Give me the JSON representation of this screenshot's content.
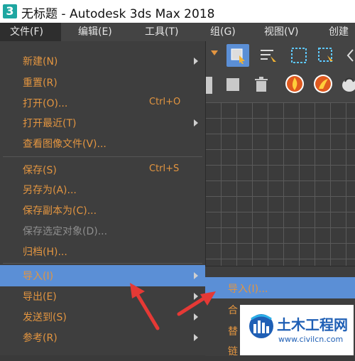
{
  "window": {
    "app_icon": "3",
    "title": "无标题 - Autodesk 3ds Max 2018"
  },
  "menubar": {
    "items": [
      {
        "label": "文件(F)"
      },
      {
        "label": "编辑(E)"
      },
      {
        "label": "工具(T)"
      },
      {
        "label": "组(G)"
      },
      {
        "label": "视图(V)"
      },
      {
        "label": "创建"
      }
    ]
  },
  "file_menu": {
    "items": [
      {
        "label": "新建(N)",
        "shortcut": "",
        "submenu": true,
        "enabled": true
      },
      {
        "label": "重置(R)",
        "shortcut": "",
        "submenu": false,
        "enabled": true
      },
      {
        "label": "打开(O)...",
        "shortcut": "Ctrl+O",
        "submenu": false,
        "enabled": true
      },
      {
        "label": "打开最近(T)",
        "shortcut": "",
        "submenu": true,
        "enabled": true
      },
      {
        "label": "查看图像文件(V)...",
        "shortcut": "",
        "submenu": false,
        "enabled": true
      },
      {
        "label": "保存(S)",
        "shortcut": "Ctrl+S",
        "submenu": false,
        "enabled": true
      },
      {
        "label": "另存为(A)...",
        "shortcut": "",
        "submenu": false,
        "enabled": true
      },
      {
        "label": "保存副本为(C)...",
        "shortcut": "",
        "submenu": false,
        "enabled": true
      },
      {
        "label": "保存选定对象(D)...",
        "shortcut": "",
        "submenu": false,
        "enabled": false
      },
      {
        "label": "归档(H)...",
        "shortcut": "",
        "submenu": false,
        "enabled": true
      },
      {
        "label": "导入(I)",
        "shortcut": "",
        "submenu": true,
        "enabled": true,
        "highlighted": true
      },
      {
        "label": "导出(E)",
        "shortcut": "",
        "submenu": true,
        "enabled": true
      },
      {
        "label": "发送到(S)",
        "shortcut": "",
        "submenu": true,
        "enabled": true
      },
      {
        "label": "参考(R)",
        "shortcut": "",
        "submenu": true,
        "enabled": true
      }
    ]
  },
  "import_submenu": {
    "items": [
      {
        "label": "导入(I)...",
        "highlighted": true
      },
      {
        "label": "合"
      },
      {
        "label": "替"
      },
      {
        "label": "链"
      }
    ]
  },
  "watermark": {
    "title": "土木工程网",
    "url": "www.civilcn.com"
  },
  "colors": {
    "accent": "#5b8fd6",
    "menu_text": "#e39540",
    "annotation_arrow": "#e53935"
  }
}
